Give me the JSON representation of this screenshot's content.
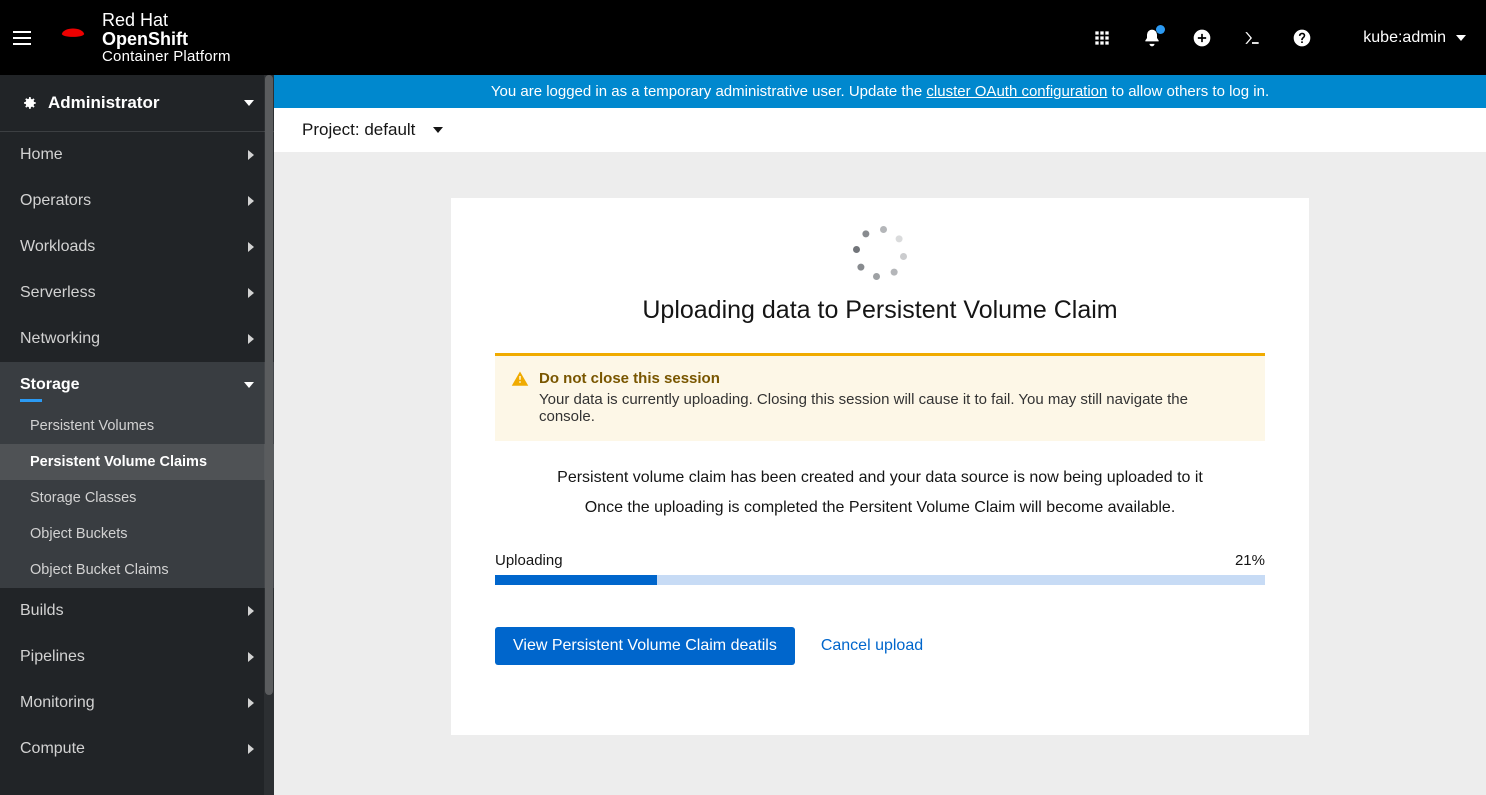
{
  "header": {
    "brand_bold": "Red Hat",
    "brand_product": "OpenShift",
    "brand_sub": "Container Platform",
    "user": "kube:admin"
  },
  "sidebar": {
    "perspective": "Administrator",
    "items": [
      {
        "label": "Home"
      },
      {
        "label": "Operators"
      },
      {
        "label": "Workloads"
      },
      {
        "label": "Serverless"
      },
      {
        "label": "Networking"
      },
      {
        "label": "Storage",
        "expanded": true,
        "children": [
          {
            "label": "Persistent Volumes"
          },
          {
            "label": "Persistent Volume Claims",
            "active": true
          },
          {
            "label": "Storage Classes"
          },
          {
            "label": "Object Buckets"
          },
          {
            "label": "Object Bucket Claims"
          }
        ]
      },
      {
        "label": "Builds"
      },
      {
        "label": "Pipelines"
      },
      {
        "label": "Monitoring"
      },
      {
        "label": "Compute"
      }
    ]
  },
  "banner": {
    "prefix": "You are logged in as a temporary administrative user. Update the ",
    "link": "cluster OAuth configuration",
    "suffix": " to allow others to log in."
  },
  "project": {
    "label": "Project: default"
  },
  "card": {
    "title": "Uploading data to Persistent Volume Claim",
    "alert_title": "Do not close this session",
    "alert_body": "Your data is currently uploading. Closing this session will cause it to fail. You may still navigate the console.",
    "desc_line1": "Persistent volume claim has been created and your data source is now being uploaded to it",
    "desc_line2": "Once the uploading is completed the Persitent Volume Claim will become available.",
    "progress_label": "Uploading",
    "progress_pct_text": "21%",
    "progress_pct": 21,
    "btn_view": "View Persistent Volume Claim deatils",
    "btn_cancel": "Cancel upload"
  }
}
